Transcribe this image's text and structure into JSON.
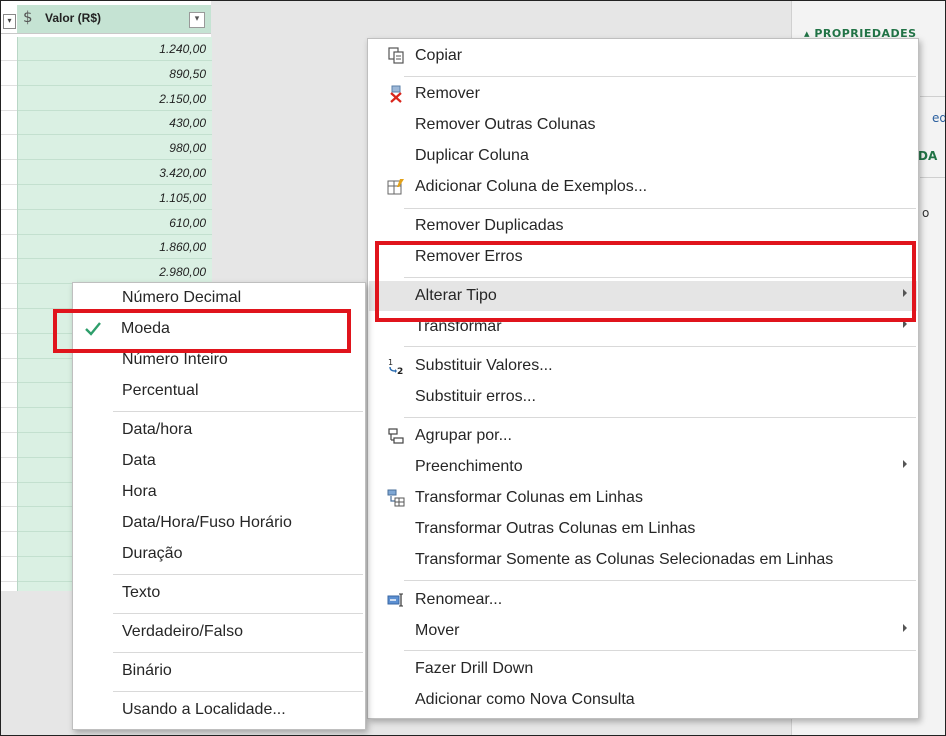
{
  "grid": {
    "column_header": {
      "title": "Valor (R$)",
      "type_icon": "$"
    },
    "values": [
      "1.240,00",
      "890,50",
      "2.150,00",
      "430,00",
      "980,00",
      "3.420,00",
      "1.105,00",
      "610,00",
      "1.860,00",
      "2.980,00"
    ]
  },
  "right_panel": {
    "title": "▴ PROPRIEDADES",
    "fragment_1": "edad",
    "fragment_2": "DA",
    "fragment_3": "o"
  },
  "context_menu": {
    "copy": "Copiar",
    "remove": "Remover",
    "remove_other_columns": "Remover Outras Colunas",
    "duplicate_column": "Duplicar Coluna",
    "add_column_from_examples": "Adicionar Coluna de Exemplos...",
    "remove_duplicates": "Remover Duplicadas",
    "remove_errors": "Remover Erros",
    "change_type": "Alterar Tipo",
    "transform": "Transformar",
    "replace_values": "Substituir Valores...",
    "replace_errors": "Substituir erros...",
    "group_by": "Agrupar por...",
    "fill": "Preenchimento",
    "unpivot_columns": "Transformar Colunas em Linhas",
    "unpivot_other_columns": "Transformar Outras Colunas em Linhas",
    "unpivot_selected_only": "Transformar Somente as Colunas Selecionadas em Linhas",
    "rename": "Renomear...",
    "move": "Mover",
    "drill_down": "Fazer Drill Down",
    "add_as_new_query": "Adicionar como Nova Consulta"
  },
  "type_submenu": {
    "decimal": "Número Decimal",
    "currency": "Moeda",
    "whole_number": "Número Inteiro",
    "percentage": "Percentual",
    "datetime": "Data/hora",
    "date": "Data",
    "time": "Hora",
    "datetimezone": "Data/Hora/Fuso Horário",
    "duration": "Duração",
    "text": "Texto",
    "boolean": "Verdadeiro/Falso",
    "binary": "Binário",
    "using_locale": "Usando a Localidade...",
    "selected": "Moeda"
  },
  "colors": {
    "column_header_bg": "#c5e3d3",
    "column_body_bg": "#daf0e3",
    "highlight_box": "#e0141c",
    "checkmark": "#2e9e6b",
    "accent_green": "#217346"
  },
  "icons": [
    "copy-icon",
    "remove-icon",
    "examples-icon",
    "replace-values-icon",
    "group-by-icon",
    "unpivot-icon",
    "rename-icon",
    "checkmark-icon",
    "chevron-right-icon",
    "filter-dropdown-icon"
  ]
}
